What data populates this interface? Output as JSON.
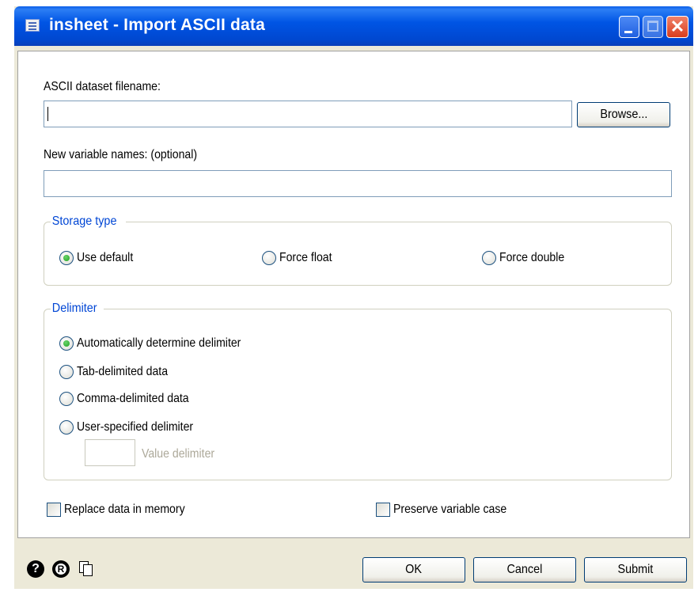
{
  "window": {
    "title": "insheet - Import ASCII data"
  },
  "filename": {
    "label": "ASCII dataset filename:",
    "value": "",
    "browse_label": "Browse..."
  },
  "varnames": {
    "label": "New variable names: (optional)",
    "value": ""
  },
  "storage": {
    "legend": "Storage type",
    "options": [
      {
        "label": "Use default",
        "selected": true
      },
      {
        "label": "Force float",
        "selected": false
      },
      {
        "label": "Force double",
        "selected": false
      }
    ]
  },
  "delimiter": {
    "legend": "Delimiter",
    "options": [
      {
        "label": "Automatically determine delimiter",
        "selected": true
      },
      {
        "label": "Tab-delimited data",
        "selected": false
      },
      {
        "label": "Comma-delimited data",
        "selected": false
      },
      {
        "label": "User-specified delimiter",
        "selected": false
      }
    ],
    "value_delimiter_label": "Value delimiter"
  },
  "options": {
    "replace_label": "Replace data in memory",
    "preserve_label": "Preserve variable case"
  },
  "buttons": {
    "ok": "OK",
    "cancel": "Cancel",
    "submit": "Submit"
  },
  "icons": {
    "help": "help-icon",
    "reset": "reset-icon",
    "copy": "copy-command-icon"
  }
}
